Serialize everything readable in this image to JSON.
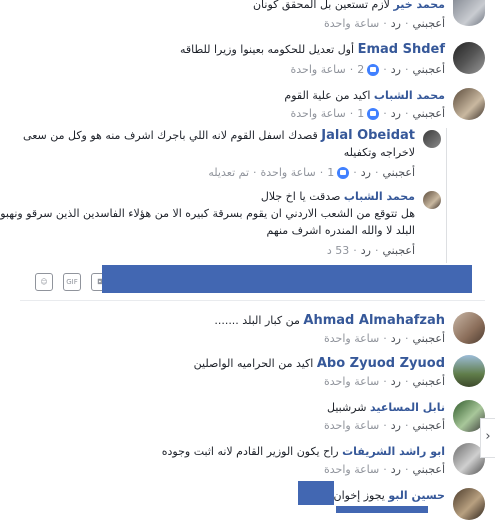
{
  "comments": [
    {
      "id": "c0",
      "author": "محمد خير",
      "text": "لازم تستعين بل المحقق كونان",
      "actions": {
        "like": "أعجبني",
        "reply": "رد",
        "time": "ساعة واحدة"
      }
    },
    {
      "id": "c1",
      "author": "Emad Shdef",
      "text": "أول تعديل للحكومه بعينوا وزيرا للطاقه",
      "actions": {
        "like": "أعجبني",
        "reply": "رد",
        "likes": "2",
        "time": "ساعة واحدة"
      }
    },
    {
      "id": "c2",
      "author": "محمد الشباب",
      "text": "اكيد من علية القوم",
      "actions": {
        "like": "أعجبني",
        "reply": "رد",
        "likes": "1",
        "time": "ساعة واحدة"
      }
    },
    {
      "id": "c3",
      "author": "Jalal Obeidat",
      "text_line1": "قصدك اسفل القوم لانه اللي باجرك اشرف منه هو وكل من سعى",
      "text_line2": "لاخراجه وتكفيله",
      "actions": {
        "like": "أعجبني",
        "reply": "رد",
        "likes": "1",
        "time": "ساعة واحدة",
        "edited": "تم تعديله"
      }
    },
    {
      "id": "c4",
      "author": "محمد الشباب",
      "text_line1": "صدقت يا اخ جلال",
      "text_line2": "هل تتوقع من الشعب الاردني ان يقوم بسرقة كبيره الا من هؤلاء الفاسدين الذين سرقو ونهبو",
      "text_line3": "البلد لا والله المندره اشرف منهم",
      "actions": {
        "like": "أعجبني",
        "reply": "رد",
        "time": "53 د"
      }
    },
    {
      "id": "c5",
      "author": "Ahmad Almahafzah",
      "text": "من كبار البلد .......",
      "actions": {
        "like": "أعجبني",
        "reply": "رد",
        "time": "ساعة واحدة"
      }
    },
    {
      "id": "c6",
      "author": "Abo Zyuod Zyuod",
      "text": "اكيد من الحراميه الواصلين",
      "actions": {
        "like": "أعجبني",
        "reply": "رد",
        "time": "ساعة واحدة"
      }
    },
    {
      "id": "c7",
      "author": "نابل المساعيد",
      "text": "شرشبيل",
      "actions": {
        "like": "أعجبني",
        "reply": "رد",
        "time": "ساعة واحدة"
      }
    },
    {
      "id": "c8",
      "author": "ابو راشد الشريفات",
      "text": "راح يكون الوزير القادم لانه اثبت وجوده",
      "actions": {
        "like": "أعجبني",
        "reply": "رد",
        "time": "ساعة واحدة"
      }
    },
    {
      "id": "c9",
      "author": "حسين البو",
      "text": "يجوز إخوان"
    }
  ],
  "reply_toolbar": {
    "gif_label": "GIF"
  },
  "scroll_arrow": "›",
  "colors": {
    "author": "#365899",
    "like": "#4080ff",
    "block": "#4267b2"
  }
}
